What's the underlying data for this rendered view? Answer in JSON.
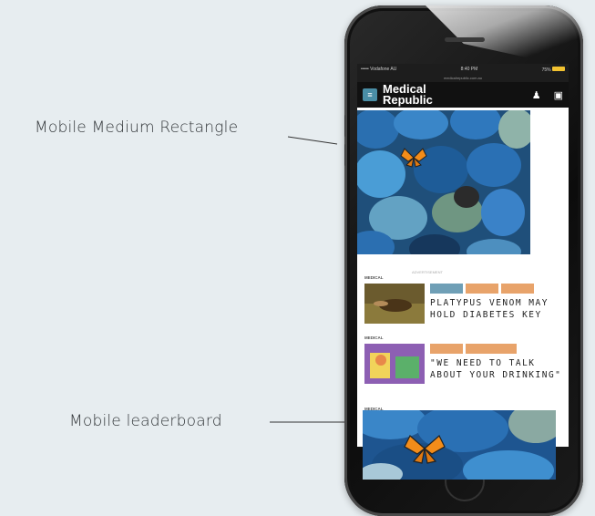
{
  "callouts": {
    "medium_rectangle": "Mobile Medium Rectangle",
    "leaderboard": "Mobile leaderboard"
  },
  "status_bar": {
    "carrier": "••••• Vodafone AU",
    "time": "8:40 PM",
    "battery": "75%"
  },
  "url_bar": "medicalrepublic.com.au",
  "app_header": {
    "logo_line1": "Medical",
    "logo_line2": "Republic",
    "menu_icon": "hamburger-menu-icon",
    "user_icon": "user-icon",
    "search_icon": "chat-icon"
  },
  "ad_caption": "ADVERTISEMENT",
  "articles": [
    {
      "section": "MEDICAL",
      "tags": [
        "",
        "",
        ""
      ],
      "title": "Platypus venom may hold diabetes key"
    },
    {
      "section": "MEDICAL",
      "tags": [
        "",
        ""
      ],
      "title": "\"We need to talk about your drinking\""
    }
  ],
  "section_3_label": "MEDICAL",
  "colors": {
    "page_bg": "#e7edf0",
    "tag_blue": "#6f9fb6",
    "tag_orange": "#e8a36a",
    "phone_body": "#111111",
    "menu_accent": "#4a8ea6"
  }
}
